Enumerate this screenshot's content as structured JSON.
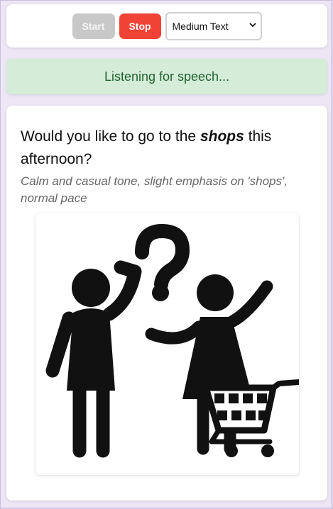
{
  "controls": {
    "start_label": "Start",
    "stop_label": "Stop",
    "text_size": {
      "selected": "Medium Text",
      "options": [
        "Medium Text"
      ]
    }
  },
  "status": {
    "text": "Listening for speech..."
  },
  "phrase": {
    "before": "Would you like to go to the ",
    "emphasis": "shops",
    "after": " this afternoon?"
  },
  "tone_note": "Calm and casual tone, slight emphasis on 'shops', normal pace",
  "picture": {
    "icons": [
      "person-icon",
      "question-mark-icon",
      "person-icon",
      "shopping-cart-icon"
    ]
  },
  "colors": {
    "start_disabled": "#c8c8c8",
    "stop": "#f14236",
    "status_bg": "#d5ecd9",
    "status_text": "#23622f"
  }
}
